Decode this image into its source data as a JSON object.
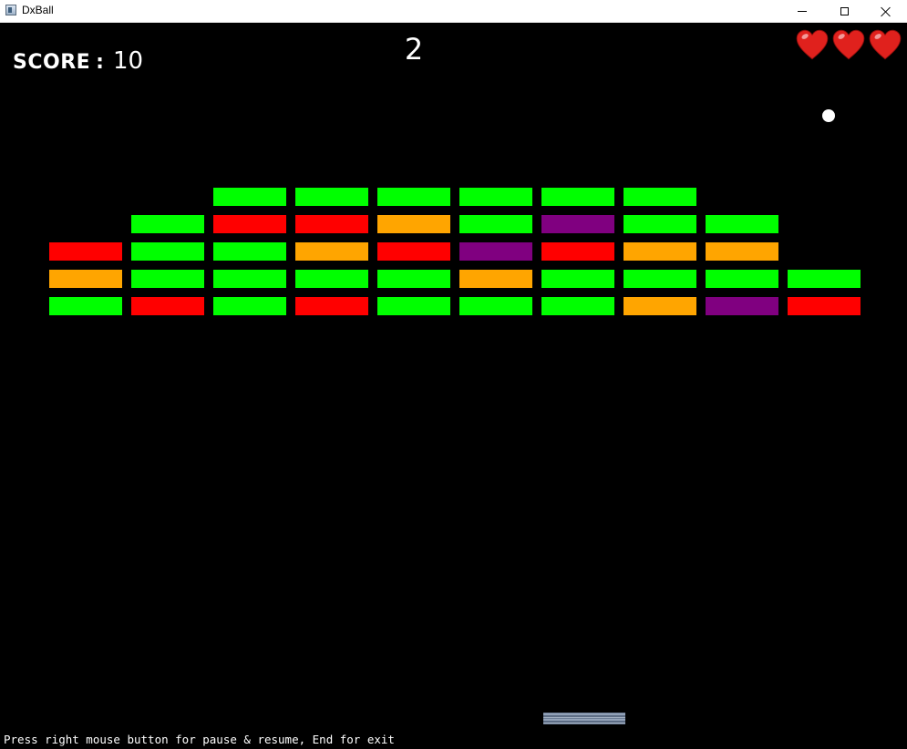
{
  "window": {
    "title": "DxBall",
    "icon": "app-window-icon"
  },
  "window_controls": {
    "minimize": "minimize-icon",
    "maximize": "maximize-icon",
    "close": "close-icon"
  },
  "hud": {
    "score_label": "SCORE",
    "score_separator": ":",
    "score_value": "10",
    "level": "2",
    "lives": 3,
    "life_icon": "heart-icon",
    "life_color": "#e0211d"
  },
  "colors": {
    "green": "#00ff00",
    "red": "#ff0000",
    "orange": "#ffa500",
    "purple": "#800080",
    "ball": "#ffffff",
    "background": "#000000"
  },
  "bricks": {
    "rows": [
      [
        "",
        "",
        "green",
        "green",
        "green",
        "green",
        "green",
        "green",
        "",
        ""
      ],
      [
        "",
        "green",
        "red",
        "red",
        "orange",
        "green",
        "purple",
        "green",
        "green",
        ""
      ],
      [
        "red",
        "green",
        "green",
        "orange",
        "red",
        "purple",
        "red",
        "orange",
        "orange",
        ""
      ],
      [
        "orange",
        "green",
        "green",
        "green",
        "green",
        "orange",
        "green",
        "green",
        "green",
        "green"
      ],
      [
        "green",
        "red",
        "green",
        "red",
        "green",
        "green",
        "green",
        "orange",
        "purple",
        "red"
      ]
    ]
  },
  "footer": {
    "hint": "Press right mouse button for pause & resume, End for exit"
  }
}
